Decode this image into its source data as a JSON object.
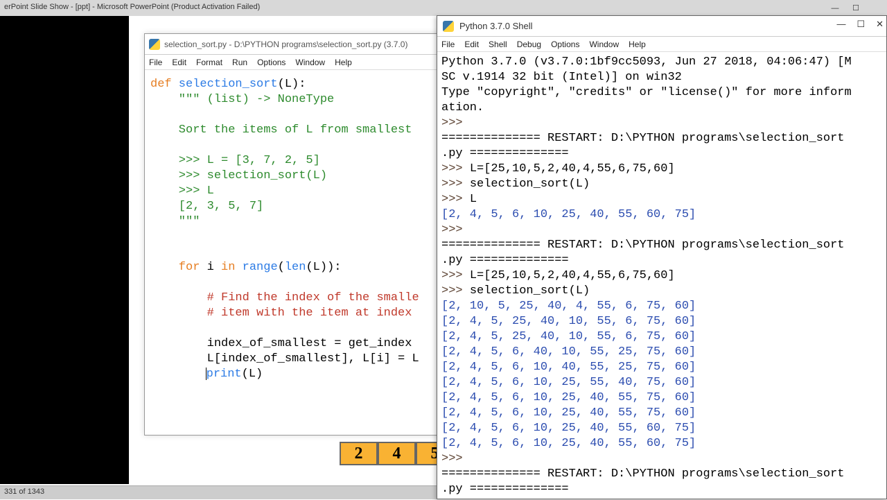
{
  "ppt": {
    "title": "erPoint Slide Show - [ppt] - Microsoft PowerPoint (Product Activation Failed)",
    "status": "331 of 1343",
    "boxes": [
      "2",
      "4",
      "5"
    ]
  },
  "editor": {
    "title": "selection_sort.py - D:\\PYTHON programs\\selection_sort.py (3.7.0)",
    "menu": [
      "File",
      "Edit",
      "Format",
      "Run",
      "Options",
      "Window",
      "Help"
    ],
    "code": {
      "l1a": "def",
      "l1b": " selection_sort",
      "l1c": "(L):",
      "l2": "    \"\"\" (list) -> NoneType",
      "l3": "",
      "l4": "    Sort the items of L from smallest",
      "l5": "",
      "l6": "    >>> L = [3, 7, 2, 5]",
      "l7": "    >>> selection_sort(L)",
      "l8": "    >>> L",
      "l9": "    [2, 3, 5, 7]",
      "l10": "    \"\"\"",
      "l11": "",
      "l12": "",
      "l13a": "    for",
      "l13b": " i ",
      "l13c": "in",
      "l13d": " range",
      "l13e": "(",
      "l13f": "len",
      "l13g": "(L)):",
      "l14": "",
      "l15": "        # Find the index of the smalle",
      "l16": "        # item with the item at index ",
      "l17": "",
      "l18": "        index_of_smallest = get_index",
      "l19": "        L[index_of_smallest], L[i] = L",
      "l20a": "        ",
      "l20b": "print",
      "l20c": "(L)"
    }
  },
  "shell": {
    "title": "Python 3.7.0 Shell",
    "menu": [
      "File",
      "Edit",
      "Shell",
      "Debug",
      "Options",
      "Window",
      "Help"
    ],
    "winbtns": {
      "min": "—",
      "max": "☐",
      "close": "✕"
    },
    "lines": [
      {
        "t": "plain",
        "s": "Python 3.7.0 (v3.7.0:1bf9cc5093, Jun 27 2018, 04:06:47) [M"
      },
      {
        "t": "plain",
        "s": "SC v.1914 32 bit (Intel)] on win32"
      },
      {
        "t": "plain",
        "s": "Type \"copyright\", \"credits\" or \"license()\" for more inform"
      },
      {
        "t": "plain",
        "s": "ation."
      },
      {
        "t": "prompt",
        "s": ">>> "
      },
      {
        "t": "restart",
        "s": "============== RESTART: D:\\PYTHON programs\\selection_sort"
      },
      {
        "t": "restart",
        "s": ".py =============="
      },
      {
        "t": "cmd",
        "p": ">>> ",
        "s": "L=[25,10,5,2,40,4,55,6,75,60]"
      },
      {
        "t": "cmd",
        "p": ">>> ",
        "s": "selection_sort(L)"
      },
      {
        "t": "cmd",
        "p": ">>> ",
        "s": "L"
      },
      {
        "t": "out",
        "s": "[2, 4, 5, 6, 10, 25, 40, 55, 60, 75]"
      },
      {
        "t": "prompt",
        "s": ">>> "
      },
      {
        "t": "restart",
        "s": "============== RESTART: D:\\PYTHON programs\\selection_sort"
      },
      {
        "t": "restart",
        "s": ".py =============="
      },
      {
        "t": "cmd",
        "p": ">>> ",
        "s": "L=[25,10,5,2,40,4,55,6,75,60]"
      },
      {
        "t": "cmd",
        "p": ">>> ",
        "s": "selection_sort(L)"
      },
      {
        "t": "out",
        "s": "[2, 10, 5, 25, 40, 4, 55, 6, 75, 60]"
      },
      {
        "t": "out",
        "s": "[2, 4, 5, 25, 40, 10, 55, 6, 75, 60]"
      },
      {
        "t": "out",
        "s": "[2, 4, 5, 25, 40, 10, 55, 6, 75, 60]"
      },
      {
        "t": "out",
        "s": "[2, 4, 5, 6, 40, 10, 55, 25, 75, 60]"
      },
      {
        "t": "out",
        "s": "[2, 4, 5, 6, 10, 40, 55, 25, 75, 60]"
      },
      {
        "t": "out",
        "s": "[2, 4, 5, 6, 10, 25, 55, 40, 75, 60]"
      },
      {
        "t": "out",
        "s": "[2, 4, 5, 6, 10, 25, 40, 55, 75, 60]"
      },
      {
        "t": "out",
        "s": "[2, 4, 5, 6, 10, 25, 40, 55, 75, 60]"
      },
      {
        "t": "out",
        "s": "[2, 4, 5, 6, 10, 25, 40, 55, 60, 75]"
      },
      {
        "t": "out",
        "s": "[2, 4, 5, 6, 10, 25, 40, 55, 60, 75]"
      },
      {
        "t": "prompt",
        "s": ">>> "
      },
      {
        "t": "restart",
        "s": "============== RESTART: D:\\PYTHON programs\\selection_sort"
      },
      {
        "t": "restart",
        "s": ".py =============="
      }
    ]
  }
}
